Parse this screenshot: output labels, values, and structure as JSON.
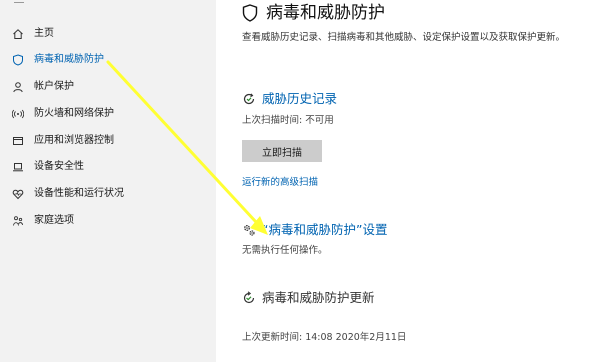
{
  "sidebar": {
    "items": [
      {
        "label": "主页",
        "icon": "home-icon"
      },
      {
        "label": "病毒和威胁防护",
        "icon": "shield-icon"
      },
      {
        "label": "帐户保护",
        "icon": "person-icon"
      },
      {
        "label": "防火墙和网络保护",
        "icon": "wifi-icon"
      },
      {
        "label": "应用和浏览器控制",
        "icon": "browser-window-icon"
      },
      {
        "label": "设备安全性",
        "icon": "laptop-icon"
      },
      {
        "label": "设备性能和运行状况",
        "icon": "heart-icon"
      },
      {
        "label": "家庭选项",
        "icon": "family-icon"
      }
    ]
  },
  "main": {
    "title": "病毒和威胁防护",
    "description": "查看威胁历史记录、扫描病毒和其他威胁、设定保护设置以及获取保护更新。",
    "history": {
      "title": "威胁历史记录",
      "last_scan": "上次扫描时间:  不可用",
      "scan_button": "立即扫描",
      "advanced_link": "运行新的高级扫描"
    },
    "settings": {
      "title": "“病毒和威胁防护”设置",
      "status": "无需执行任何操作。"
    },
    "updates": {
      "title": "病毒和威胁防护更新",
      "last_update": "上次更新时间: 14:08 2020年2月11日"
    }
  },
  "colors": {
    "accent": "#0063b1",
    "sidebar_bg": "#f2f2f2",
    "annotation_arrow": "#ffff33"
  }
}
